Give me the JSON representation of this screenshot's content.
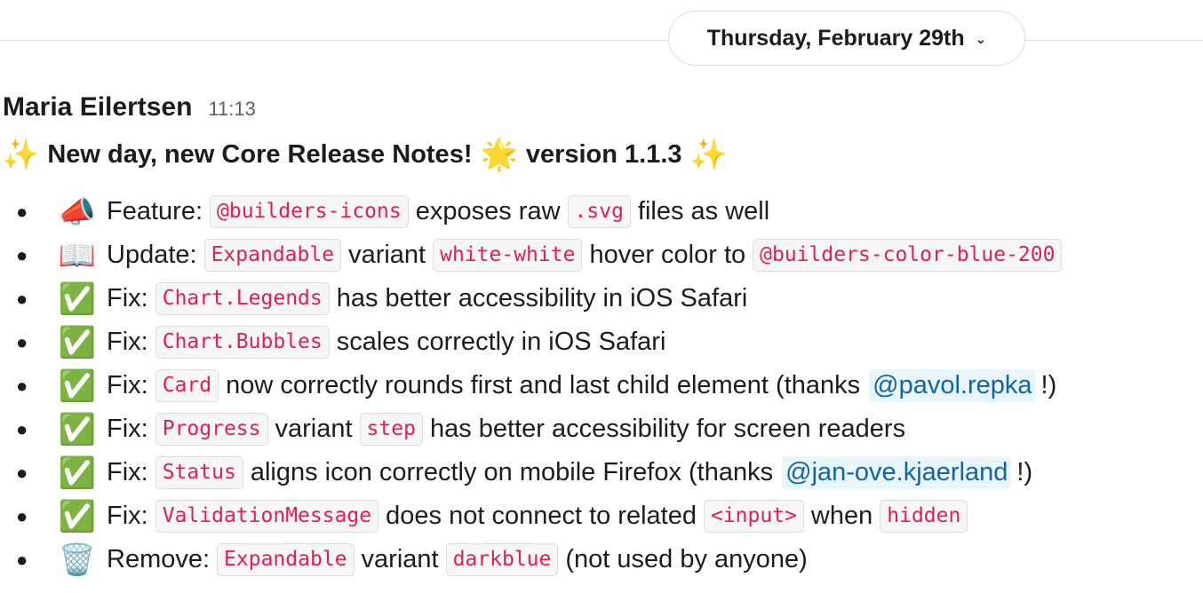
{
  "date_divider": {
    "label": "Thursday, February 29th",
    "chevron": "⌄"
  },
  "message": {
    "author": "Maria Eilertsen",
    "time": "11:13",
    "headline": {
      "sparkle_left": "✨",
      "text1": "New day, new Core Release Notes!",
      "star": "🌟",
      "text2": "version 1.1.3",
      "sparkle_right": "✨"
    },
    "notes": [
      {
        "emoji": "📣",
        "kind": "Feature:",
        "parts": [
          {
            "t": "code",
            "v": "@builders-icons"
          },
          {
            "t": "text",
            "v": "exposes raw"
          },
          {
            "t": "code",
            "v": ".svg"
          },
          {
            "t": "text",
            "v": "files as well"
          }
        ]
      },
      {
        "emoji": "📖",
        "kind": "Update:",
        "parts": [
          {
            "t": "code",
            "v": "Expandable"
          },
          {
            "t": "text",
            "v": "variant"
          },
          {
            "t": "code",
            "v": "white-white"
          },
          {
            "t": "text",
            "v": "hover color to"
          },
          {
            "t": "code",
            "v": "@builders-color-blue-200"
          }
        ]
      },
      {
        "emoji": "✅",
        "kind": "Fix:",
        "parts": [
          {
            "t": "code",
            "v": "Chart.Legends"
          },
          {
            "t": "text",
            "v": "has better accessibility in iOS Safari"
          }
        ]
      },
      {
        "emoji": "✅",
        "kind": "Fix:",
        "parts": [
          {
            "t": "code",
            "v": "Chart.Bubbles"
          },
          {
            "t": "text",
            "v": "scales correctly in iOS Safari"
          }
        ]
      },
      {
        "emoji": "✅",
        "kind": "Fix:",
        "parts": [
          {
            "t": "code",
            "v": "Card"
          },
          {
            "t": "text",
            "v": "now correctly rounds first and last child element (thanks"
          },
          {
            "t": "mention",
            "v": "@pavol.repka"
          },
          {
            "t": "tail",
            "v": "!)"
          }
        ]
      },
      {
        "emoji": "✅",
        "kind": "Fix:",
        "parts": [
          {
            "t": "code",
            "v": "Progress"
          },
          {
            "t": "text",
            "v": "variant"
          },
          {
            "t": "code",
            "v": "step"
          },
          {
            "t": "text",
            "v": "has better accessibility for screen readers"
          }
        ]
      },
      {
        "emoji": "✅",
        "kind": "Fix:",
        "parts": [
          {
            "t": "code",
            "v": "Status"
          },
          {
            "t": "text",
            "v": "aligns icon correctly on mobile Firefox (thanks"
          },
          {
            "t": "mention",
            "v": "@jan-ove.kjaerland"
          },
          {
            "t": "tail",
            "v": "!)"
          }
        ]
      },
      {
        "emoji": "✅",
        "kind": "Fix:",
        "parts": [
          {
            "t": "code",
            "v": "ValidationMessage"
          },
          {
            "t": "text",
            "v": "does not connect to related"
          },
          {
            "t": "code",
            "v": "<input>"
          },
          {
            "t": "text",
            "v": "when"
          },
          {
            "t": "code",
            "v": "hidden"
          }
        ]
      },
      {
        "emoji": "🗑️",
        "kind": "Remove:",
        "parts": [
          {
            "t": "code",
            "v": "Expandable"
          },
          {
            "t": "text",
            "v": "variant"
          },
          {
            "t": "code",
            "v": "darkblue"
          },
          {
            "t": "text",
            "v": "(not used by anyone)"
          }
        ]
      }
    ]
  },
  "colors": {
    "code_text": "#e01e5a",
    "code_bg": "#f6f6f6",
    "mention_text": "#1264a3",
    "mention_bg": "#e8f5fa",
    "divider": "#dddddd"
  },
  "icons": {
    "feature": "megaphone-icon",
    "update": "open-book-icon",
    "fix": "check-mark-button-icon",
    "remove": "wastebasket-icon"
  }
}
